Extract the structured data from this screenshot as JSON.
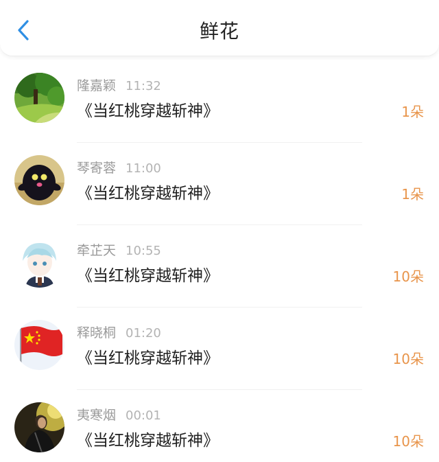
{
  "header": {
    "title": "鲜花",
    "back_icon": "chevron-left-icon",
    "accent_color": "#2f8fe4"
  },
  "count_color": "#e8944a",
  "items": [
    {
      "name": "隆嘉颖",
      "time": "11:32",
      "book": "《当红桃穿越斩神》",
      "count": "1朵",
      "avatar_icon": "forest-avatar"
    },
    {
      "name": "琴寄蓉",
      "time": "11:00",
      "book": "《当红桃穿越斩神》",
      "count": "1朵",
      "avatar_icon": "black-creature-avatar"
    },
    {
      "name": "牵芷天",
      "time": "10:55",
      "book": "《当红桃穿越斩神》",
      "count": "10朵",
      "avatar_icon": "anime-boy-avatar"
    },
    {
      "name": "释晓桐",
      "time": "01:20",
      "book": "《当红桃穿越斩神》",
      "count": "10朵",
      "avatar_icon": "china-flag-avatar"
    },
    {
      "name": "夷寒烟",
      "time": "00:01",
      "book": "《当红桃穿越斩神》",
      "count": "10朵",
      "avatar_icon": "person-photo-avatar"
    }
  ]
}
